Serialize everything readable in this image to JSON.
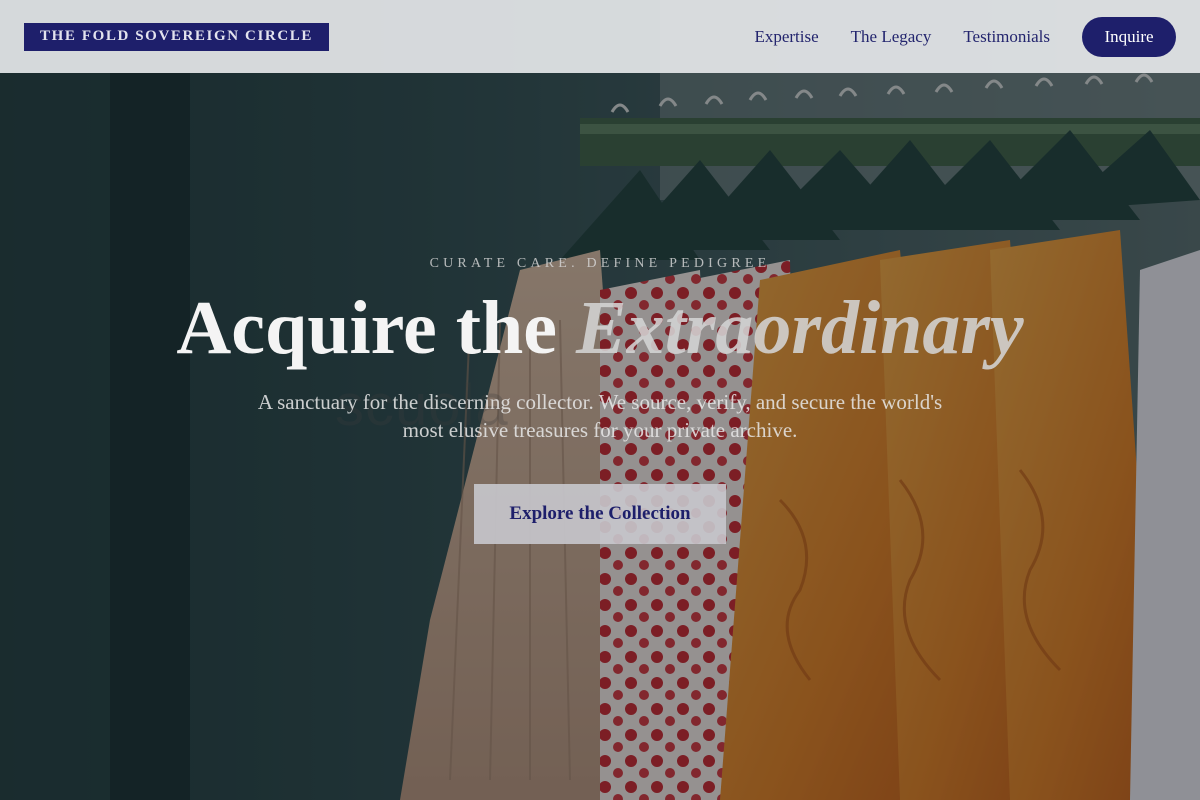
{
  "brand": {
    "logo_text": "THE FOLD SOVEREIGN CIRCLE"
  },
  "nav": {
    "links": [
      "Expertise",
      "The Legacy",
      "Testimonials"
    ],
    "cta_label": "Inquire"
  },
  "hero": {
    "eyebrow": "CURATE CARE. DEFINE PEDIGREE",
    "headline_main": "Acquire the",
    "headline_accent": "Extraordinary",
    "ghost_text": "scuola",
    "subtext": "A sanctuary for the discerning collector. We source, verify, and secure the world's most elusive treasures for your private archive.",
    "cta_label": "Explore the Collection",
    "background_image": "clothing rack with hangers and garments"
  },
  "colors": {
    "brand_navy": "#1e1f6b",
    "nav_bg": "#e4e6e8",
    "cta_bg": "#c8c8cd"
  }
}
